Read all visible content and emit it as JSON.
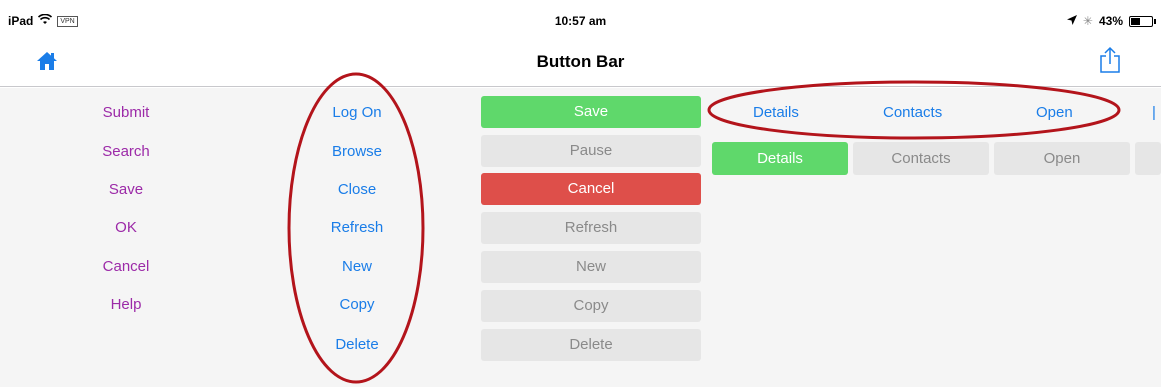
{
  "status_bar": {
    "device": "iPad",
    "vpn": "VPN",
    "time": "10:57 am",
    "battery": "43%",
    "battery_level": 0.43
  },
  "nav": {
    "title": "Button Bar",
    "home_icon": "home-icon",
    "share_icon": "share-icon"
  },
  "columns": {
    "text_purple": [
      "Submit",
      "Search",
      "Save",
      "OK",
      "Cancel",
      "Help"
    ],
    "text_blue": [
      "Log On",
      "Browse",
      "Close",
      "Refresh",
      "New",
      "Copy",
      "Delete"
    ],
    "boxes": [
      {
        "label": "Save",
        "style": "green"
      },
      {
        "label": "Pause",
        "style": "gray"
      },
      {
        "label": "Cancel",
        "style": "red"
      },
      {
        "label": "Refresh",
        "style": "gray"
      },
      {
        "label": "New",
        "style": "gray"
      },
      {
        "label": "Copy",
        "style": "gray"
      },
      {
        "label": "Delete",
        "style": "gray"
      }
    ]
  },
  "tab_bar_text": [
    "Details",
    "Contacts",
    "Open"
  ],
  "tab_bar_boxes": [
    {
      "label": "Details",
      "style": "green"
    },
    {
      "label": "Contacts",
      "style": "gray"
    },
    {
      "label": "Open",
      "style": "gray"
    }
  ],
  "colors": {
    "green": "#5fd86b",
    "red": "#de4f4a",
    "gray": "#e6e6e6",
    "purple_text": "#9c2aa8",
    "blue_text": "#1a7de8",
    "annotation": "#b3141b"
  }
}
